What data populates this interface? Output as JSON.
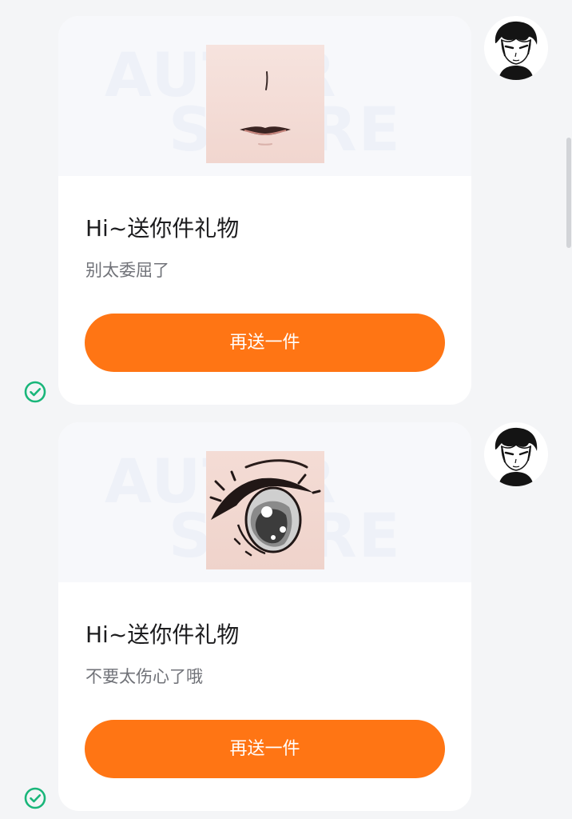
{
  "colors": {
    "background": "#f4f5f7",
    "card": "#ffffff",
    "accent_button": "#ff7514",
    "sent_check": "#19b67a",
    "title_text": "#1c1c1e",
    "subtitle_text": "#707278"
  },
  "messages": [
    {
      "watermark": [
        "AUTAR",
        "STORE"
      ],
      "gift_icon": "mouth-sticker-icon",
      "title": "Hi~送你件礼物",
      "subtitle": "别太委屈了",
      "button_label": "再送一件",
      "status_icon": "check-circle-icon",
      "avatar_icon": "avatar-anime-boy"
    },
    {
      "watermark": [
        "AUTAR",
        "STORE"
      ],
      "gift_icon": "eye-sticker-icon",
      "title": "Hi~送你件礼物",
      "subtitle": "不要太伤心了哦",
      "button_label": "再送一件",
      "status_icon": "check-circle-icon",
      "avatar_icon": "avatar-anime-boy"
    }
  ]
}
